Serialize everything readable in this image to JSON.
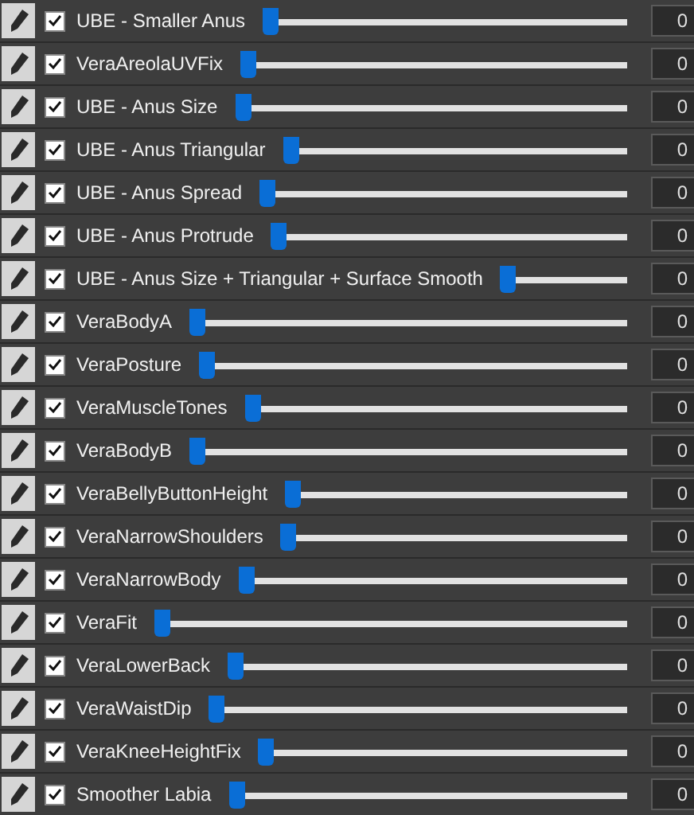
{
  "sliders": [
    {
      "label": "UBE - Smaller Anus",
      "checked": true,
      "level": 0,
      "value": "0"
    },
    {
      "label": "VeraAreolaUVFix",
      "checked": true,
      "level": 0,
      "value": "0"
    },
    {
      "label": "UBE - Anus Size",
      "checked": true,
      "level": 0,
      "value": "0"
    },
    {
      "label": "UBE - Anus Triangular",
      "checked": true,
      "level": 0,
      "value": "0"
    },
    {
      "label": "UBE - Anus Spread",
      "checked": true,
      "level": 0,
      "value": "0"
    },
    {
      "label": "UBE - Anus Protrude",
      "checked": true,
      "level": 0,
      "value": "0"
    },
    {
      "label": "UBE - Anus Size + Triangular + Surface Smooth",
      "checked": true,
      "level": 0,
      "value": "0"
    },
    {
      "label": "VeraBodyA",
      "checked": true,
      "level": 0,
      "value": "0"
    },
    {
      "label": "VeraPosture",
      "checked": true,
      "level": 0,
      "value": "0"
    },
    {
      "label": "VeraMuscleTones",
      "checked": true,
      "level": 0,
      "value": "0"
    },
    {
      "label": "VeraBodyB",
      "checked": true,
      "level": 0,
      "value": "0"
    },
    {
      "label": "VeraBellyButtonHeight",
      "checked": true,
      "level": 0,
      "value": "0"
    },
    {
      "label": "VeraNarrowShoulders",
      "checked": true,
      "level": 0,
      "value": "0"
    },
    {
      "label": "VeraNarrowBody",
      "checked": true,
      "level": 0,
      "value": "0"
    },
    {
      "label": "VeraFit",
      "checked": true,
      "level": 0,
      "value": "0"
    },
    {
      "label": "VeraLowerBack",
      "checked": true,
      "level": 0,
      "value": "0"
    },
    {
      "label": "VeraWaistDip",
      "checked": true,
      "level": 0,
      "value": "0"
    },
    {
      "label": "VeraKneeHeightFix",
      "checked": true,
      "level": 0,
      "value": "0"
    },
    {
      "label": "Smoother Labia",
      "checked": true,
      "level": 0,
      "value": "0"
    }
  ]
}
